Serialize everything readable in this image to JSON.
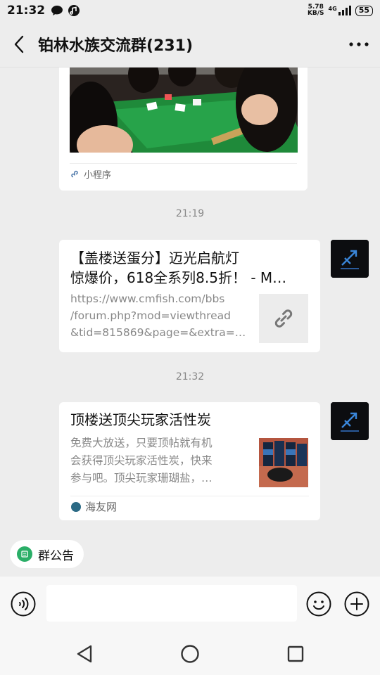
{
  "status_bar": {
    "time": "21:32",
    "net_speed_value": "5.78",
    "net_speed_unit": "KB/S",
    "signal": "4G",
    "battery": "55"
  },
  "header": {
    "title": "铂林水族交流群(231)"
  },
  "messages": [
    {
      "type": "mini_program_card",
      "footer_label": "小程序"
    },
    {
      "type": "timestamp",
      "text": "21:19"
    },
    {
      "type": "link_card",
      "title_line1": "【盖楼送蛋分】迈光启航灯",
      "title_line2": "惊爆价，618全系列8.5折！ - M…",
      "desc_line1": "https://www.cmfish.com/bbs",
      "desc_line2": "/forum.php?mod=viewthread",
      "desc_line3": "&tid=815869&page=&extra=…"
    },
    {
      "type": "timestamp",
      "text": "21:32"
    },
    {
      "type": "link_card",
      "title": "顶楼送顶尖玩家活性炭",
      "desc_line1": "免费大放送，只要顶帖就有机",
      "desc_line2": "会获得顶尖玩家活性炭，快来",
      "desc_line3": "参与吧。顶尖玩家珊瑚盐，…",
      "source": "海友网"
    }
  ],
  "announcement": {
    "label": "群公告"
  },
  "input_bar": {
    "placeholder": ""
  },
  "colors": {
    "background": "#ededed",
    "card": "#ffffff",
    "accent_green": "#2aae67",
    "muted_text": "#888888"
  },
  "icons": [
    "back-arrow-icon",
    "more-icon",
    "mini-program-icon",
    "link-icon",
    "voice-icon",
    "emoji-icon",
    "plus-icon",
    "nav-back-icon",
    "nav-home-icon",
    "nav-recents-icon",
    "announcement-icon",
    "site-icon"
  ]
}
